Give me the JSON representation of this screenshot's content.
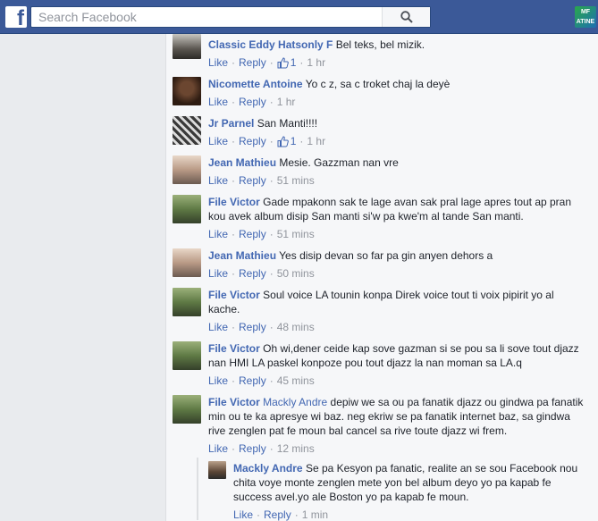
{
  "search": {
    "placeholder": "Search Facebook"
  },
  "topbar": {
    "logo": "f",
    "app_badge": "MF ATINE",
    "brand_color": "#3b5998"
  },
  "icons": {
    "search": "magnifier-icon",
    "like": "thumbs-up-icon"
  },
  "actions": {
    "like": "Like",
    "reply": "Reply",
    "sep": "·"
  },
  "comments": [
    {
      "author": "Classic Eddy Hatsonly F",
      "text": "Bel teks, bel mizik.",
      "likes": "1",
      "time": "1 hr"
    },
    {
      "author": "Nicomette Antoine",
      "text": "Yo c z, sa c troket chaj la deyè",
      "time": "1 hr"
    },
    {
      "author": "Jr Parnel",
      "text": "San Manti!!!!",
      "likes": "1",
      "time": "1 hr"
    },
    {
      "author": "Jean Mathieu",
      "text": "Mesie. Gazzman nan vre",
      "time": "51 mins"
    },
    {
      "author": "File Victor",
      "text": "Gade mpakonn sak te lage avan sak pral lage apres tout ap pran kou avek album disip San manti si'w pa kwe'm al tande San manti.",
      "time": "51 mins"
    },
    {
      "author": "Jean Mathieu",
      "text": "Yes disip devan so far pa gin anyen dehors a",
      "time": "50 mins"
    },
    {
      "author": "File Victor",
      "text": "Soul voice LA tounin konpa Direk voice tout ti voix pipirit yo al kache.",
      "time": "48 mins"
    },
    {
      "author": "File Victor",
      "text": "Oh wi,dener ceide kap sove gazman si se pou sa li sove tout djazz nan HMI LA paskel konpoze pou tout djazz la nan moman sa LA.q",
      "time": "45 mins"
    },
    {
      "author": "File Victor",
      "mention": "Mackly Andre",
      "text": "depiw we sa ou pa fanatik djazz ou gindwa pa fanatik min ou te ka apresye wi baz. neg ekriw se pa fanatik internet baz, sa gindwa rive zenglen pat fe moun bal cancel sa rive toute djazz wi frem.",
      "time": "12 mins"
    }
  ],
  "reply": {
    "author": "Mackly Andre",
    "text": "Se pa Kesyon pa fanatic, realite an se sou Facebook nou chita voye monte zenglen mete yon bel album deyo yo pa kapab fe success avel.yo ale Boston yo pa kapab fe moun.",
    "time": "1 min"
  }
}
